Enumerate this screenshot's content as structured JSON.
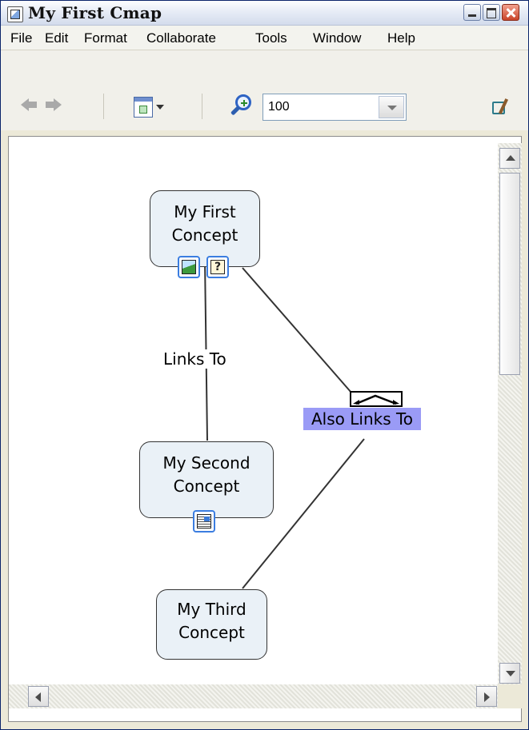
{
  "window": {
    "title": "My First Cmap"
  },
  "menu": {
    "items": [
      "File",
      "Edit",
      "Format",
      "Collaborate",
      "Tools",
      "Window",
      "Help"
    ]
  },
  "toolbar": {
    "back_icon": "left-arrow-icon",
    "forward_icon": "right-arrow-icon",
    "view_icon": "view-mode-icon",
    "zoom_icon": "zoom-in-icon",
    "zoom_value": "100",
    "tools_icon": "cmap-tools-icon"
  },
  "concepts": [
    {
      "label_line1": "My First",
      "label_line2": "Concept",
      "resources": [
        "image-resource-icon",
        "question-resource-icon"
      ]
    },
    {
      "label_line1": "My Second",
      "label_line2": "Concept",
      "resources": [
        "document-resource-icon"
      ]
    },
    {
      "label_line1": "My Third",
      "label_line2": "Concept",
      "resources": []
    }
  ],
  "links": [
    {
      "label": "Links To",
      "from": "My First Concept",
      "to": "My Second Concept"
    },
    {
      "label": "Also Links To",
      "from": "My First Concept",
      "to": "My Third Concept",
      "selected": true
    }
  ],
  "colors": {
    "concept_fill": "#eaf1f7",
    "selection_highlight": "#9a9bf6",
    "resource_border": "#3b7de0"
  }
}
